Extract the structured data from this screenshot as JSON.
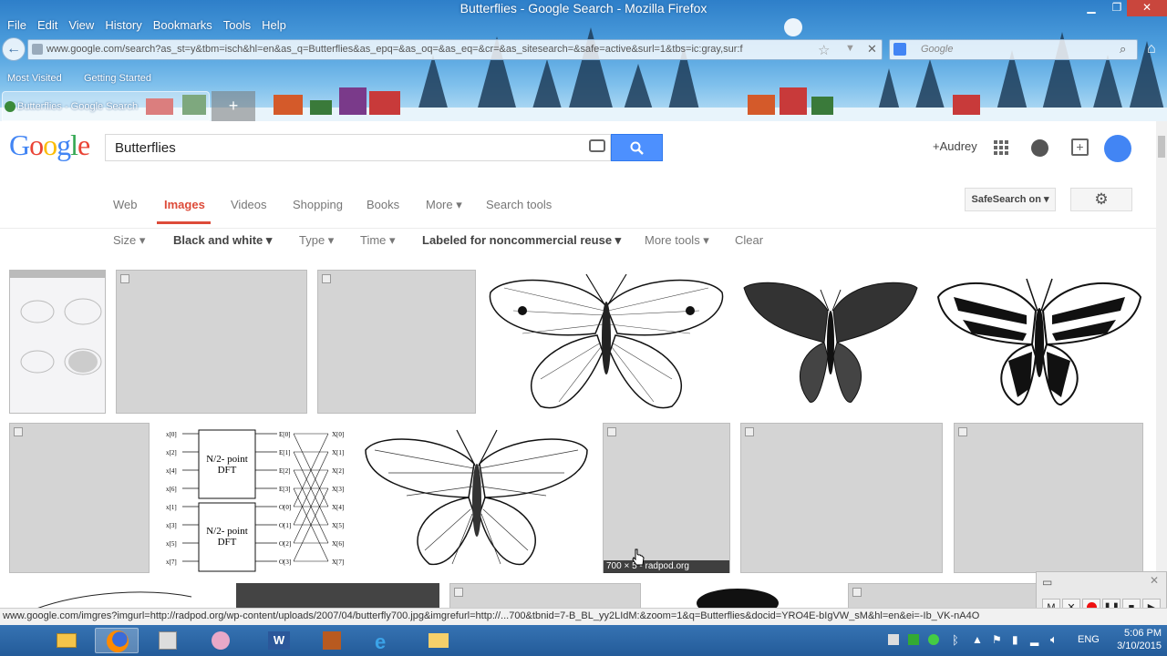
{
  "window": {
    "title": "Butterflies - Google Search - Mozilla Firefox"
  },
  "menu": [
    "File",
    "Edit",
    "View",
    "History",
    "Bookmarks",
    "Tools",
    "Help"
  ],
  "urlbar": {
    "url": "www.google.com/search?as_st=y&tbm=isch&hl=en&as_q=Butterflies&as_epq=&as_oq=&as_eq=&cr=&as_sitesearch=&safe=active&surl=1&tbs=ic:gray,sur:f"
  },
  "searchbar": {
    "placeholder": "Google"
  },
  "bookmarks": [
    "Most Visited",
    "Getting Started"
  ],
  "tab": {
    "title": "Butterflies - Google Search",
    "new_tab": "+"
  },
  "google": {
    "logo": "Google",
    "query": "Butterflies",
    "user": "+Audrey",
    "nav": [
      "Web",
      "Images",
      "Videos",
      "Shopping",
      "Books",
      "More ▾",
      "Search tools"
    ],
    "safesearch": "SafeSearch on ▾",
    "tools": [
      "Size ▾",
      "Black and white ▾",
      "Type ▾",
      "Time ▾",
      "Labeled for noncommercial reuse ▾",
      "More tools ▾",
      "Clear"
    ],
    "hover_caption": "700 × 5  - radpod.org",
    "dft": {
      "block1": "N/2- point DFT",
      "block2": "N/2- point DFT",
      "inputs": [
        "x[0]",
        "x[2]",
        "x[4]",
        "x[6]",
        "x[1]",
        "x[3]",
        "x[5]",
        "x[7]"
      ],
      "mid": [
        "E[0]",
        "E[1]",
        "E[2]",
        "E[3]",
        "O[0]",
        "O[1]",
        "O[2]",
        "O[3]"
      ],
      "outputs": [
        "X[0]",
        "X[1]",
        "X[2]",
        "X[3]",
        "X[4]",
        "X[5]",
        "X[6]",
        "X[7]"
      ]
    }
  },
  "status": {
    "url": "www.google.com/imgres?imgurl=http://radpod.org/wp-content/uploads/2007/04/butterfly700.jpg&imgrefurl=http://...700&tbnid=7-B_BL_yy2LIdM:&zoom=1&q=Butterflies&docid=YRO4E-bIgVW_sM&hl=en&ei=-Ib_VK-nA4O"
  },
  "recorder": {
    "buttons": [
      "M",
      "✕",
      "",
      "❚❚",
      "■",
      "▶"
    ]
  },
  "tray": {
    "lang": "ENG",
    "time": "5:06 PM",
    "date": "3/10/2015"
  }
}
